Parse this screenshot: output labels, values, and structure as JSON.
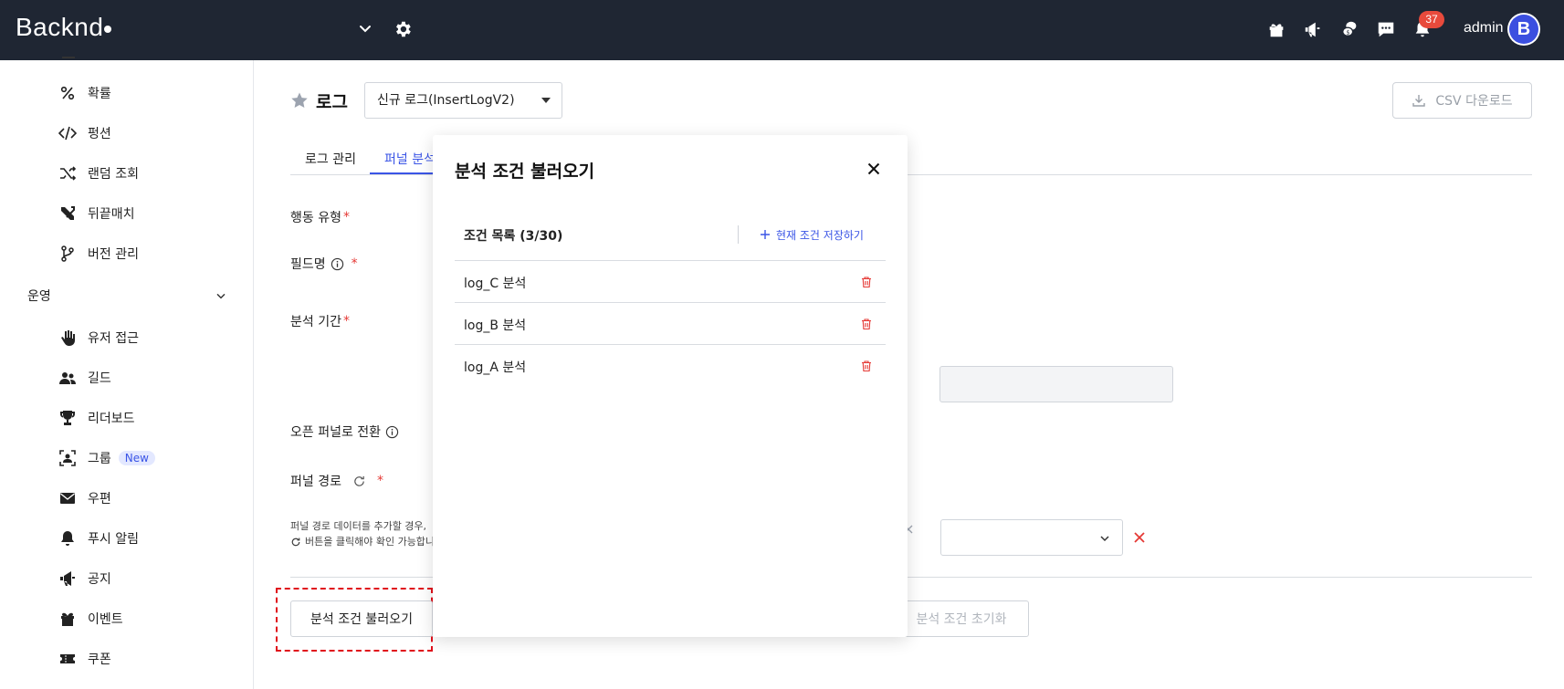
{
  "header": {
    "logo": "Backnd",
    "notifications_count": "37",
    "admin_name": "admin",
    "avatar_letter": "B",
    "icons": [
      "chevron-down-icon",
      "gear-icon",
      "gift-icon",
      "megaphone-icon",
      "coins-icon",
      "chat-icon",
      "bell-icon"
    ]
  },
  "sidebar": {
    "items_top": [
      {
        "label": "확률",
        "icon": "percent-icon"
      },
      {
        "label": "펑션",
        "icon": "code-icon"
      },
      {
        "label": "랜덤 조회",
        "icon": "shuffle-icon"
      },
      {
        "label": "뒤끝매치",
        "icon": "swords-icon"
      },
      {
        "label": "버전 관리",
        "icon": "branch-icon"
      }
    ],
    "section_label": "운영",
    "items_ops": [
      {
        "label": "유저 접근",
        "icon": "hand-icon"
      },
      {
        "label": "길드",
        "icon": "users-icon"
      },
      {
        "label": "리더보드",
        "icon": "trophy-icon"
      },
      {
        "label": "그룹",
        "icon": "group-icon",
        "badge": "New"
      },
      {
        "label": "우편",
        "icon": "mail-icon"
      },
      {
        "label": "푸시 알림",
        "icon": "bell-icon"
      },
      {
        "label": "공지",
        "icon": "megaphone-icon"
      },
      {
        "label": "이벤트",
        "icon": "gift-icon"
      },
      {
        "label": "쿠폰",
        "icon": "ticket-icon"
      }
    ]
  },
  "page": {
    "title": "로그",
    "log_select_value": "신규 로그(InsertLogV2)",
    "csv_button": "CSV 다운로드",
    "tabs": [
      "로그 관리",
      "퍼널 분석"
    ],
    "active_tab": 1,
    "fields": {
      "action_type": "행동 유형",
      "field_name": "필드명",
      "period": "분석 기간",
      "open_funnel": "오픈 퍼널로 전환",
      "funnel_path": "퍼널 경로"
    },
    "hint_line1": "퍼널 경로 데이터를 추가할 경우,",
    "hint_line2": "버튼을 클릭해야 확인 가능합니",
    "load_button": "분석 조건 불러오기",
    "reset_button": "분석 조건 초기화"
  },
  "modal": {
    "title": "분석 조건 불러오기",
    "list_header": "조건 목록 (3/30)",
    "save_link": "현재 조건 저장하기",
    "items": [
      "log_C 분석",
      "log_B 분석",
      "log_A 분석"
    ]
  },
  "colors": {
    "topbar": "#1f2633",
    "accent": "#3b55e6",
    "danger": "#e53935"
  }
}
